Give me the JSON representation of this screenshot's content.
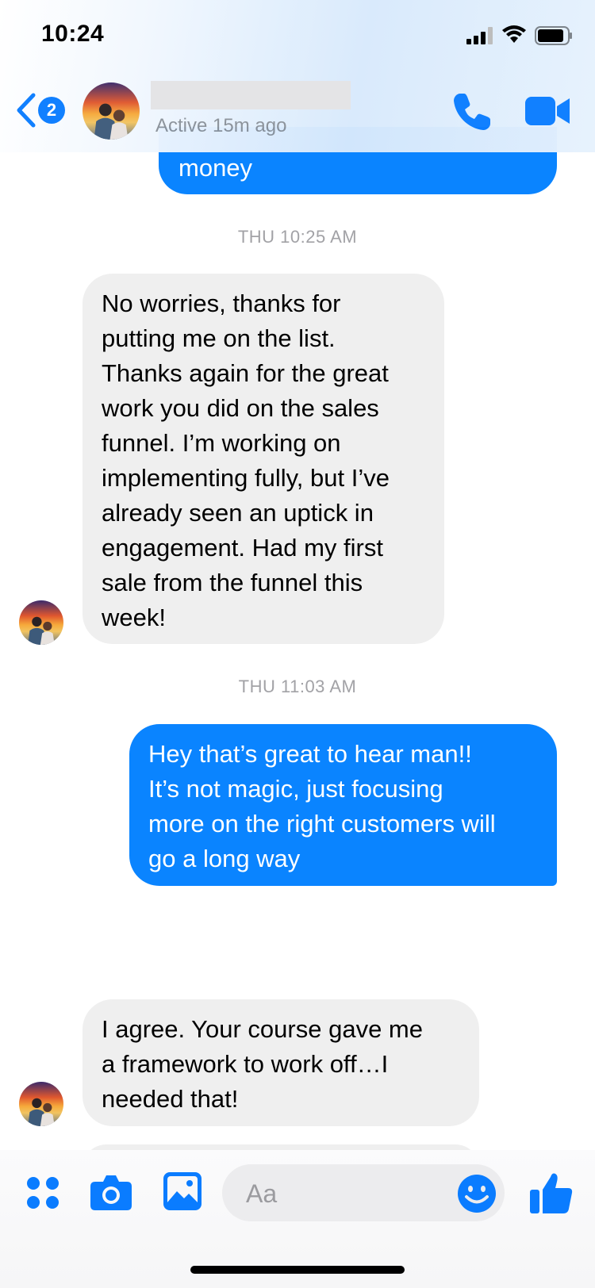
{
  "status_bar": {
    "time": "10:24"
  },
  "header": {
    "unread_count": "2",
    "contact_name": "",
    "active_status": "Active 15m ago"
  },
  "conversation": {
    "previous_message_tail": "money",
    "timestamps": [
      "THU 10:25 AM",
      "THU 11:03 AM"
    ],
    "messages": [
      {
        "direction": "incoming",
        "lines": [
          "No worries, thanks for",
          "putting me on the list.",
          "Thanks again for the great",
          "work you did on the sales",
          "funnel.  I’m working on",
          "implementing fully, but I’ve",
          "already seen an uptick in",
          "engagement.  Had my first",
          "sale from the funnel this",
          "week!"
        ]
      },
      {
        "direction": "outgoing",
        "lines": [
          "Hey that’s great to hear man!!",
          "It’s not magic, just focusing",
          "more on the right customers will",
          "go a long way"
        ]
      },
      {
        "direction": "incoming",
        "lines": [
          "I agree.  Your course gave me",
          "a framework to work off…I",
          "needed that!"
        ]
      }
    ]
  },
  "composer": {
    "placeholder": "Aa"
  },
  "colors": {
    "accent": "#0a84ff",
    "incoming_bubble": "#efefef",
    "timestamp": "#a2a2a6"
  },
  "icons": [
    "back-chevron-icon",
    "phone-icon",
    "video-camera-icon",
    "apps-grid-icon",
    "camera-icon",
    "photo-gallery-icon",
    "emoji-icon",
    "thumbs-up-icon"
  ]
}
